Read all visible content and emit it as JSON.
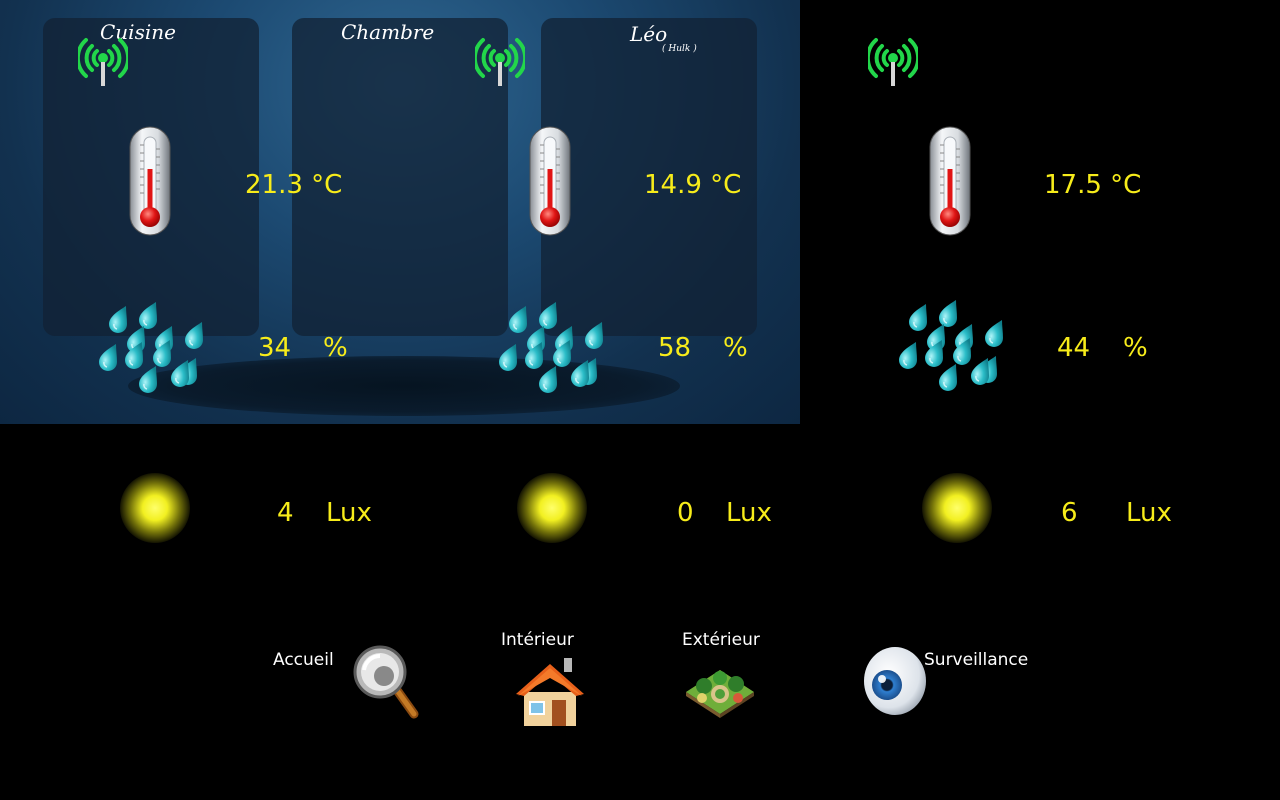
{
  "rooms": [
    {
      "title": "Cuisine",
      "subtitle": "",
      "temperature": "21.3 °C",
      "humidity_value": "34",
      "humidity_unit": "%",
      "lux_value": "4",
      "lux_unit": "Lux"
    },
    {
      "title": "Chambre",
      "subtitle": "",
      "temperature": "14.9 °C",
      "humidity_value": "58",
      "humidity_unit": "%",
      "lux_value": "0",
      "lux_unit": "Lux"
    },
    {
      "title": "Léo",
      "subtitle": "( Hulk )",
      "temperature": "17.5 °C",
      "humidity_value": "44",
      "humidity_unit": "%",
      "lux_value": "6",
      "lux_unit": "Lux"
    }
  ],
  "nav": {
    "home_label": "Accueil",
    "interior_label": "Intérieur",
    "exterior_label": "Extérieur",
    "surveillance_label": "Surveillance"
  },
  "colors": {
    "value_text": "#f7ec1a",
    "signal_icon": "#22d64a",
    "water_drop": "#2bbdc8",
    "lux_glow": "#f2f021"
  },
  "icons": {
    "signal": "wireless-signal-icon",
    "temperature": "thermometer-icon",
    "humidity": "water-drops-icon",
    "light": "light-glow-icon",
    "home": "magnifier-icon",
    "interior": "house-icon",
    "exterior": "garden-icon",
    "surveillance": "eye-icon"
  }
}
